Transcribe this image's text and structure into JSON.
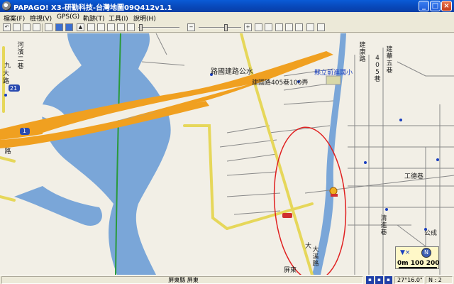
{
  "window": {
    "title": "PAPAGO!  X3-研勤科技-台灣地圖09Q412v1.1"
  },
  "menu": [
    {
      "label": "檔案(F)"
    },
    {
      "label": "檢視(V)"
    },
    {
      "label": "GPS(G)"
    },
    {
      "label": "軌跡(T)"
    },
    {
      "label": "工具(I)"
    },
    {
      "label": "說明(H)"
    }
  ],
  "map": {
    "labels": {
      "road_yupo_school": "縣立前進國小",
      "road_jianguo": "建國路405巷100弄",
      "road_nine": "九",
      "road_big": "大",
      "road_route": "路",
      "road_chao": "屏",
      "road_dax": "大",
      "road_pingtung": "屏東",
      "highway_21": "21",
      "highway_1": "1"
    },
    "vertical_labels": {
      "river_st": "河濱二巷",
      "jian_a": "建康路",
      "num_405": "405巷",
      "jian_b": "建華五巷",
      "qingjin": "清進巷",
      "jianping": "建平巷",
      "daxi": "大溪路",
      "road_left": "路"
    },
    "road_names": {
      "guojian_road": "路國建路公水"
    },
    "right_labels": {
      "xingshe": "工德巷",
      "gongcheng": "公成路",
      "gongcheng2": "公成"
    },
    "scale": {
      "label": "0m 100  200",
      "north": "N"
    }
  },
  "status": {
    "location": "屏東縣  屏東",
    "coord_lat": "27°16.0\"",
    "coord_n": "N : 2"
  }
}
